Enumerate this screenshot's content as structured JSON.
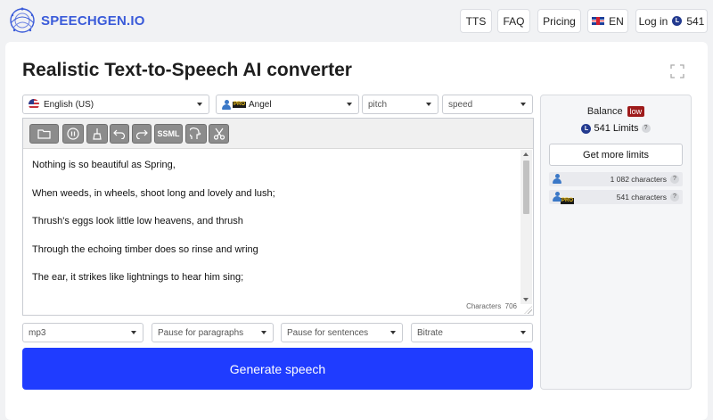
{
  "header": {
    "logo_text": "SPEECHGEN.IO",
    "nav": {
      "tts": "TTS",
      "faq": "FAQ",
      "pricing": "Pricing",
      "language": "EN",
      "login": "Log in",
      "balance": "541"
    }
  },
  "page": {
    "title": "Realistic Text-to-Speech AI converter"
  },
  "controls": {
    "language": "English (US)",
    "voice": "Angel",
    "pitch": "pitch",
    "speed": "speed"
  },
  "toolbar": {
    "ssml_label": "SSML"
  },
  "editor": {
    "lines": [
      "Nothing is so beautiful as Spring,",
      "When weeds, in wheels, shoot long and lovely and lush;",
      "Thrush's eggs look little low heavens, and thrush",
      "Through the echoing timber does so rinse and wring",
      "The ear, it strikes like lightnings to hear him sing;"
    ],
    "char_label": "Characters",
    "char_count": "706"
  },
  "output": {
    "format": "mp3",
    "pause_paragraphs": "Pause for paragraphs",
    "pause_sentences": "Pause for sentences",
    "bitrate": "Bitrate"
  },
  "generate_label": "Generate speech",
  "panel": {
    "balance_label": "Balance",
    "balance_status": "low",
    "limits_value": "541",
    "limits_label": "Limits",
    "more_limits": "Get more limits",
    "quota_free": "1 082 characters",
    "quota_pro": "541 characters",
    "pro_badge": "PRO"
  },
  "colors": {
    "brand": "#3a5bd9",
    "generate": "#1f3cff",
    "low_badge": "#9e1b1b"
  }
}
